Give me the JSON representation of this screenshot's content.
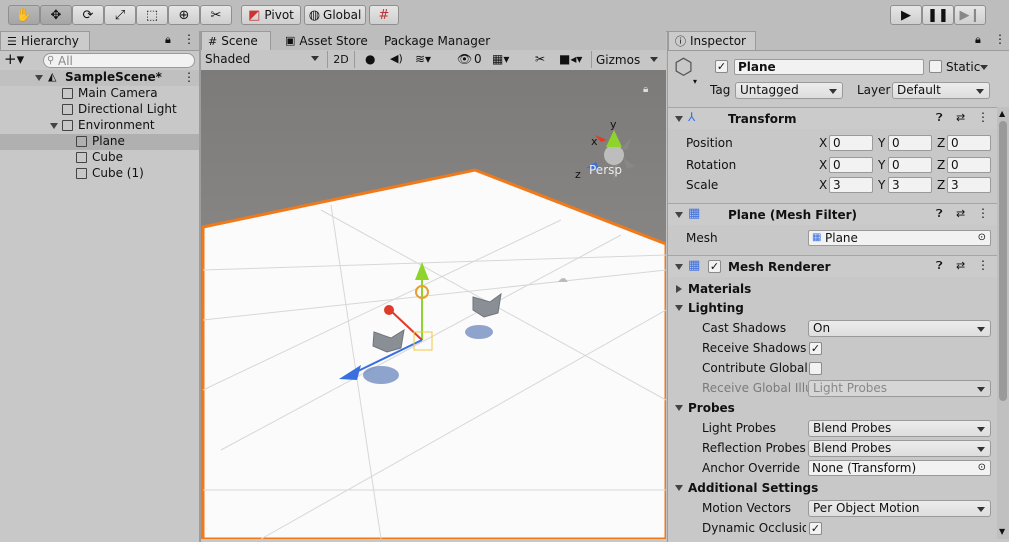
{
  "toolbar": {
    "tools": [
      "hand-tool",
      "move-tool",
      "rotate-tool",
      "scale-tool",
      "rect-tool",
      "transform-tool",
      "custom-tool"
    ],
    "pivot_label": "Pivot",
    "global_label": "Global"
  },
  "hierarchy": {
    "tab_label": "Hierarchy",
    "search_placeholder": "All",
    "scene_name": "SampleScene*",
    "items": [
      {
        "label": "Main Camera"
      },
      {
        "label": "Directional Light"
      },
      {
        "label": "Environment"
      },
      {
        "label": "Plane"
      },
      {
        "label": "Cube"
      },
      {
        "label": "Cube (1)"
      }
    ]
  },
  "scene": {
    "tabs": [
      "Scene",
      "Asset Store",
      "Package Manager"
    ],
    "shading_mode": "Shaded",
    "mode_2d": "2D",
    "hidden_count": "0",
    "gizmos_label": "Gizmos",
    "persp_label": "Persp",
    "axis_labels": {
      "x": "x",
      "y": "y",
      "z": "z"
    }
  },
  "inspector": {
    "tab_label": "Inspector",
    "object_name": "Plane",
    "static_label": "Static",
    "tag_label": "Tag",
    "tag_value": "Untagged",
    "layer_label": "Layer",
    "layer_value": "Default",
    "transform": {
      "title": "Transform",
      "position_label": "Position",
      "rotation_label": "Rotation",
      "scale_label": "Scale",
      "position": {
        "x": "0",
        "y": "0",
        "z": "0"
      },
      "rotation": {
        "x": "0",
        "y": "0",
        "z": "0"
      },
      "scale": {
        "x": "3",
        "y": "3",
        "z": "3"
      },
      "axis_x": "X",
      "axis_y": "Y",
      "axis_z": "Z"
    },
    "mesh_filter": {
      "title": "Plane (Mesh Filter)",
      "mesh_label": "Mesh",
      "mesh_value": "Plane"
    },
    "mesh_renderer": {
      "title": "Mesh Renderer",
      "materials_label": "Materials",
      "lighting_label": "Lighting",
      "cast_shadows_label": "Cast Shadows",
      "cast_shadows_value": "On",
      "receive_shadows_label": "Receive Shadows",
      "contribute_gi_label": "Contribute Global I",
      "receive_gi_label": "Receive Global Illu",
      "receive_gi_value": "Light Probes",
      "probes_label": "Probes",
      "light_probes_label": "Light Probes",
      "light_probes_value": "Blend Probes",
      "reflection_probes_label": "Reflection Probes",
      "reflection_probes_value": "Blend Probes",
      "anchor_override_label": "Anchor Override",
      "anchor_override_value": "None (Transform)",
      "additional_label": "Additional Settings",
      "motion_vectors_label": "Motion Vectors",
      "motion_vectors_value": "Per Object Motion",
      "dynamic_occlusion_label": "Dynamic Occlusion"
    }
  },
  "colors": {
    "selection_outline": "#f07a1a",
    "axis_x": "#e03a28",
    "axis_y": "#8fd42c",
    "axis_z": "#3a6fe0"
  }
}
